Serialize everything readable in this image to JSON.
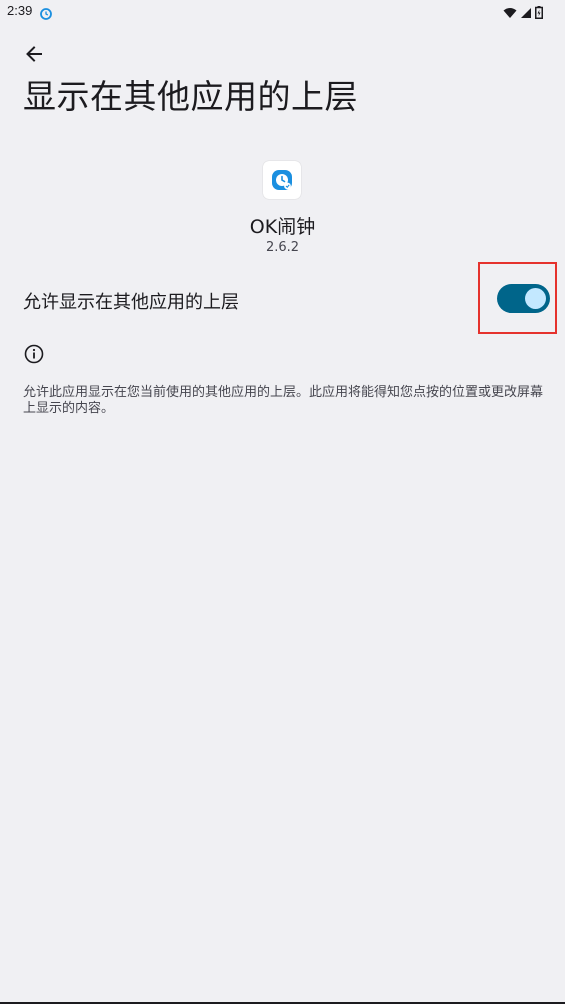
{
  "status_bar": {
    "time": "2:39",
    "icons": [
      "app-notification-icon",
      "wifi-icon",
      "cellular-signal-icon",
      "battery-icon"
    ]
  },
  "header": {
    "back_icon": "arrow-back-icon",
    "title": "显示在其他应用的上层"
  },
  "app": {
    "icon": "ok-alarm-clock-icon",
    "name": "OK闹钟",
    "version": "2.6.2"
  },
  "setting": {
    "label": "允许显示在其他应用的上层",
    "enabled": true,
    "highlight_color": "#e5322d"
  },
  "info": {
    "icon": "info-icon",
    "text": "允许此应用显示在您当前使用的其他应用的上层。此应用将能得知您点按的位置或更改屏幕上显示的内容。"
  },
  "colors": {
    "background": "#f0f0f3",
    "toggle_track": "#00658a",
    "toggle_thumb": "#c3e8ff",
    "app_icon_blue": "#1a8fe0"
  }
}
